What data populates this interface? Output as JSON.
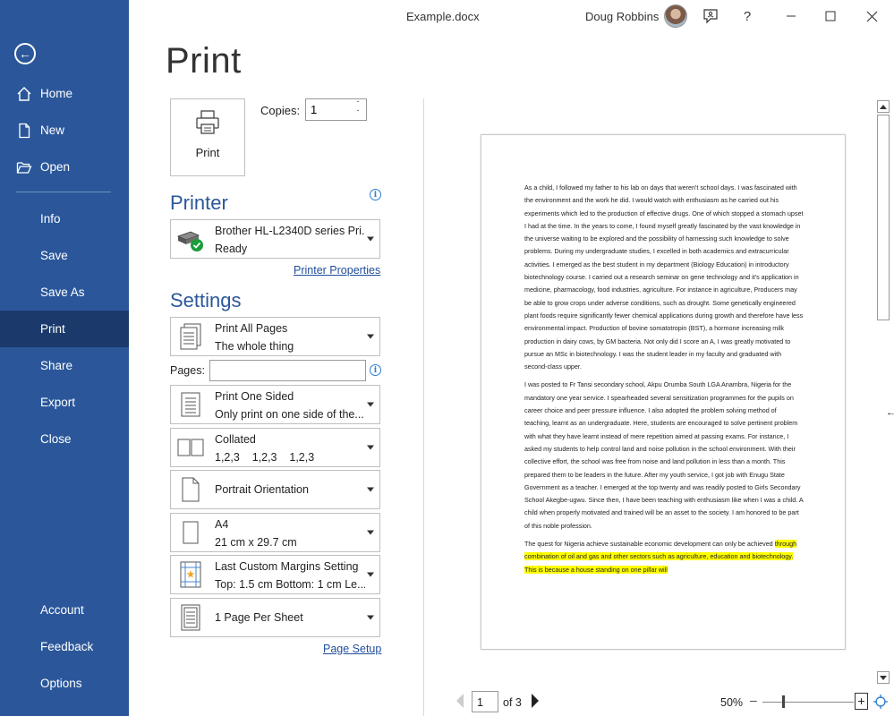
{
  "titlebar": {
    "doc_title": "Example.docx",
    "user_name": "Doug Robbins"
  },
  "sidebar": {
    "items": [
      {
        "label": "Home",
        "icon": "home-icon"
      },
      {
        "label": "New",
        "icon": "new-document-icon"
      },
      {
        "label": "Open",
        "icon": "folder-open-icon"
      },
      {
        "label": "Info"
      },
      {
        "label": "Save"
      },
      {
        "label": "Save As"
      },
      {
        "label": "Print",
        "active": true
      },
      {
        "label": "Share"
      },
      {
        "label": "Export"
      },
      {
        "label": "Close"
      }
    ],
    "bottom_items": [
      {
        "label": "Account"
      },
      {
        "label": "Feedback"
      },
      {
        "label": "Options"
      }
    ]
  },
  "print": {
    "heading": "Print",
    "button_label": "Print",
    "copies_label": "Copies:",
    "copies_value": "1"
  },
  "printer": {
    "section_title": "Printer",
    "name": "Brother HL-L2340D series Pri...",
    "status": "Ready",
    "properties_link": "Printer Properties"
  },
  "settings": {
    "section_title": "Settings",
    "pages_label": "Pages:",
    "pages_value": "",
    "range": {
      "line1": "Print All Pages",
      "line2": "The whole thing"
    },
    "sides": {
      "line1": "Print One Sided",
      "line2": "Only print on one side of the..."
    },
    "collation": {
      "line1": "Collated",
      "line2": "1,2,3    1,2,3    1,2,3"
    },
    "orientation": {
      "line1": "Portrait Orientation"
    },
    "paper": {
      "line1": "A4",
      "line2": "21 cm x 29.7 cm"
    },
    "margins": {
      "line1": "Last Custom Margins Setting",
      "line2": "Top: 1.5 cm Bottom: 1 cm Le..."
    },
    "per_sheet": {
      "line1": "1 Page Per Sheet"
    },
    "page_setup_link": "Page Setup"
  },
  "preview": {
    "paragraphs": [
      "As a child, I followed my father to his lab on days that weren't school days. I was fascinated with the environment and the work he did. I would watch with enthusiasm as he carried out his experiments which led to the production of effective drugs. One of which stopped a stomach upset I had at the time. In the years to come, I found myself greatly fascinated by the vast knowledge in the universe waiting to be explored and the possibility of harnessing such knowledge to solve problems. During my undergraduate studies, I excelled in both academics and extracurricular activities. I emerged as the best student in my department (Biology Education) in introductory biotechnology course. I carried out a research seminar on gene technology and it's application in medicine, pharmacology, food industries, agriculture. For instance in agriculture, Producers may be able to grow crops under adverse conditions, such as drought. Some genetically engineered plant foods require significantly fewer chemical applications during growth and therefore have less environmental impact. Production of bovine somatotropin (BST), a hormone increasing milk production in dairy cows, by GM bacteria. Not only did I score an A, I was greatly motivated to pursue an MSc in biotechnology. I was the student leader in my faculty and graduated with second-class upper.",
      "I was posted to Fr Tansi secondary school, Akpu Orumba South LGA Anambra, Nigeria for the mandatory one year service. I spearheaded several sensitization programmes for the pupils on career choice and peer pressure influence. I also adopted the problem solving method of teaching, learnt as an undergraduate. Here, students are encouraged to solve pertinent problem with what they have learnt instead of mere repetition aimed at passing exams. For instance, I asked my students to help control land and noise pollution in the school environment. With their collective effort, the school was free from noise and land pollution in less than a month. This prepared them to be leaders in the future. After my youth service, I got job with Enugu State Government as a teacher. I emerged at the top twenty and was readily posted to Girls Secondary School Akegbe-ugwu. Since then, I have been teaching with enthusiasm like when I was a child. A child when properly motivated and trained will be an asset to the society. I am honored to be part of this noble profession."
    ],
    "last_para_plain": "The quest for Nigeria achieve sustainable economic development can only be achieved ",
    "last_para_highlight": "through combination of oil and gas and other sectors such as agriculture, education and biotechnology. This is because a house standing on one pillar will",
    "highlight_color": "#ffff00"
  },
  "nav": {
    "current_page": "1",
    "of_label": "of 3",
    "zoom": "50%"
  },
  "colors": {
    "sidebar": "#2b579a",
    "sidebar_active": "#1b3a6b",
    "accent": "#2b579a"
  }
}
